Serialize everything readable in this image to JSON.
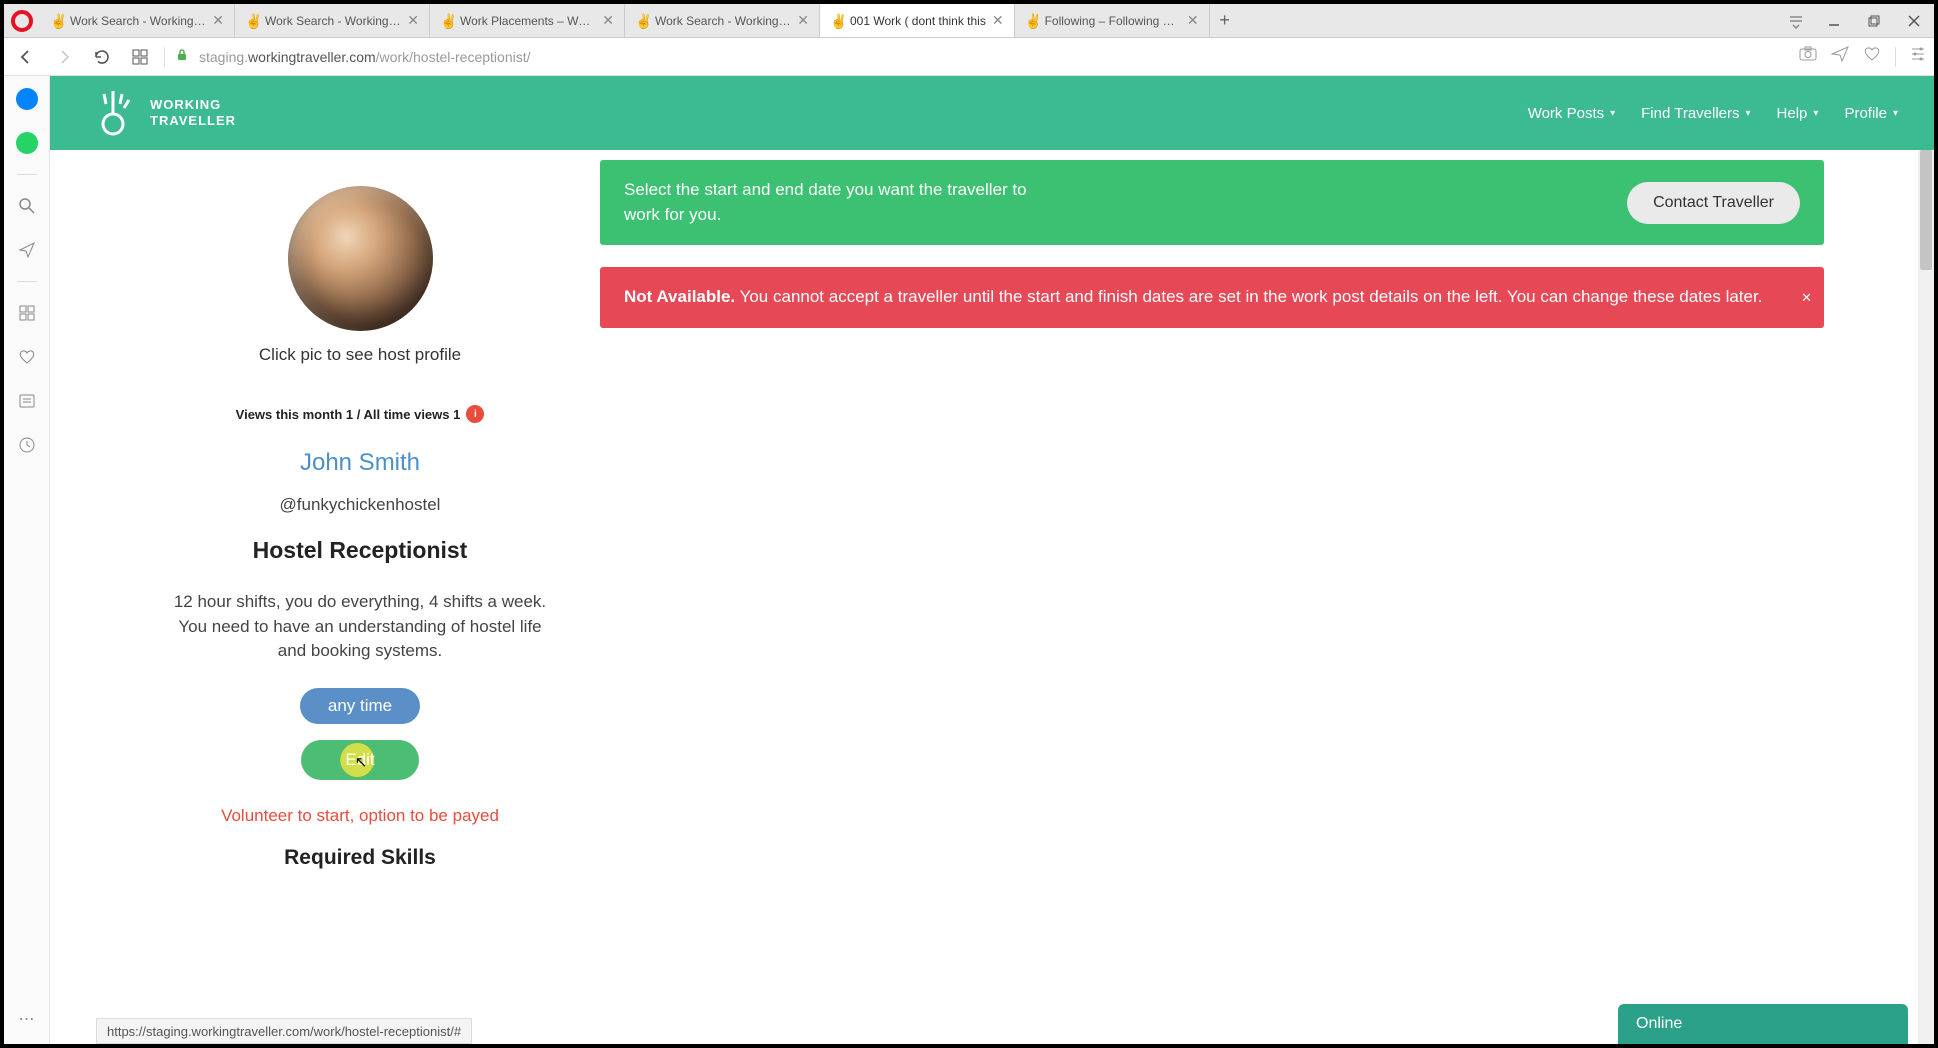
{
  "browser": {
    "tabs": [
      {
        "title": "Work Search - Working Tra"
      },
      {
        "title": "Work Search - Working Tra"
      },
      {
        "title": "Work Placements – Work P"
      },
      {
        "title": "Work Search - Working Tra"
      },
      {
        "title": "001 Work ( dont think this"
      },
      {
        "title": "Following – Following – Jo"
      }
    ],
    "active_tab_index": 4,
    "url_prefix": "staging.",
    "url_domain": "workingtraveller.com",
    "url_path": "/work/hostel-receptionist/"
  },
  "site_nav": {
    "logo_line1": "WORKING",
    "logo_line2": "TRAVELLER",
    "items": [
      "Work Posts",
      "Find Travellers",
      "Help",
      "Profile"
    ]
  },
  "profile": {
    "caption": "Click pic to see host profile",
    "views_line": "Views this month 1 / All time views 1",
    "info_badge": "i",
    "name": "John Smith",
    "handle": "@funkychickenhostel",
    "role": "Hostel Receptionist",
    "description": "12 hour shifts, you do everything, 4 shifts a week. You need to have an understanding of hostel life and booking systems.",
    "pill_blue": "any time",
    "pill_green": "Edit",
    "red_note": "Volunteer to start, option to be payed",
    "required_skills_heading": "Required Skills"
  },
  "banners": {
    "green_text": "Select the start and end date you want the traveller to work for you.",
    "contact_btn": "Contact Traveller",
    "red_bold": "Not Available.",
    "red_rest": " You cannot accept a traveller until the start and finish dates are set in the work post details on the left. You can change these dates later."
  },
  "online_widget": "Online",
  "status_url": "https://staging.workingtraveller.com/work/hostel-receptionist/#"
}
